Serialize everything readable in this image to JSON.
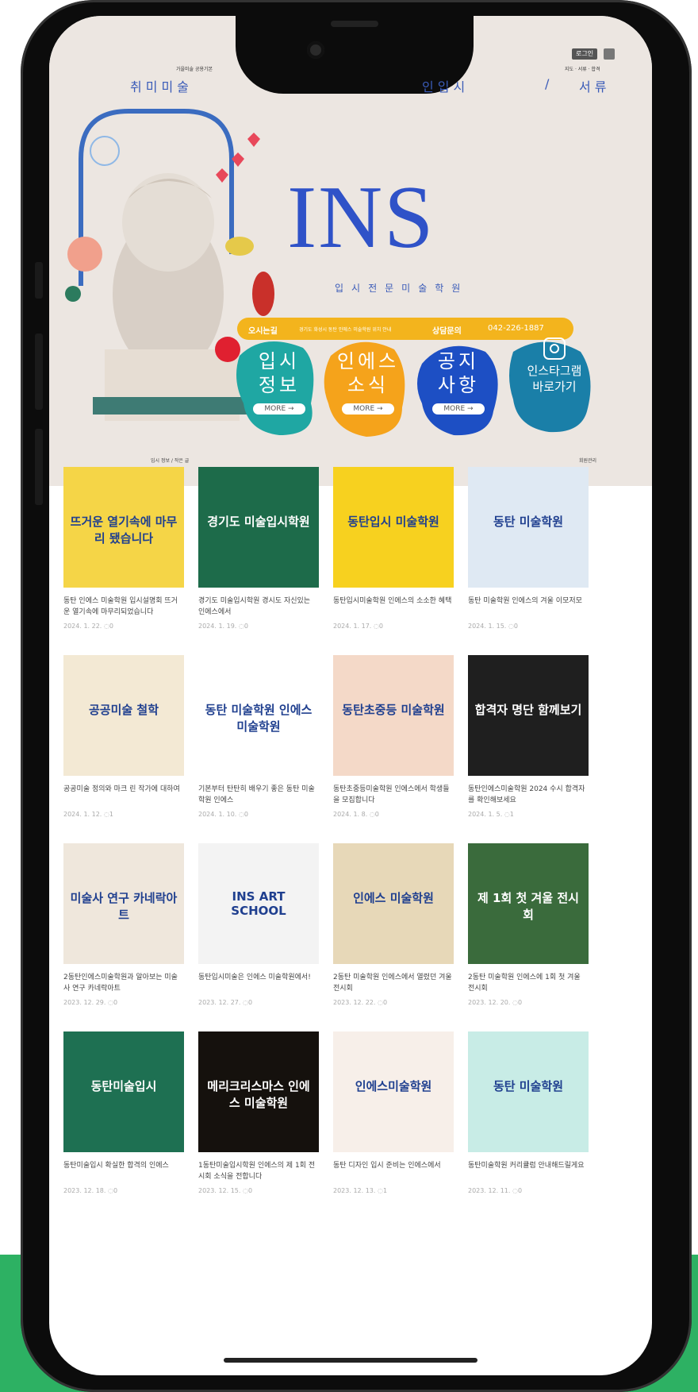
{
  "nav": {
    "left_small": "가을미술 공용기본",
    "left": "취미미술",
    "right": "인입시",
    "sep": "/",
    "right_small": "지도 · 서류 · 합격",
    "right2": "서류",
    "login": "로그인"
  },
  "hero": {
    "title": "INS",
    "subtitle": "입시전문미술학원",
    "info_directions_label": "오시는길",
    "info_directions_text": "경기도 화성시 동탄 인에스 미술학원 위치 안내",
    "info_phone_label": "상담문의",
    "info_phone": "042-226-1887",
    "buttons": [
      {
        "label": "입시\n정보",
        "more": "MORE →"
      },
      {
        "label": "인에스\n소식",
        "more": "MORE →"
      },
      {
        "label": "공지\n사항",
        "more": "MORE →"
      },
      {
        "label": "인스타그램\n바로가기",
        "more": ""
      }
    ],
    "footnote_left": "입시 정보 / 작은 글",
    "footnote_right": "회원관리"
  },
  "posts": [
    {
      "thumb": "뜨거운 열기속에 마무리 됐습니다",
      "caption": "동탄 인에스 미술학원 입시설명회 뜨거운 열기속에 마무리되었습니다",
      "date": "2024. 1. 22.",
      "comments": "0",
      "bg": "#f5d547"
    },
    {
      "thumb": "경기도 미술입시학원",
      "caption": "경기도 미술입시학원 경시도 자신있는 인에스에서",
      "date": "2024. 1. 19.",
      "comments": "0",
      "bg": "#1d6b4a"
    },
    {
      "thumb": "동탄입시 미술학원",
      "caption": "동탄입시미술학원 인에스의 소소한 혜택",
      "date": "2024. 1. 17.",
      "comments": "0",
      "bg": "#f7d11f"
    },
    {
      "thumb": "동탄 미술학원",
      "caption": "동탄 미술학원 인에스의 겨울 이모저모",
      "date": "2024. 1. 15.",
      "comments": "0",
      "bg": "#dfe9f3"
    },
    {
      "thumb": "공공미술 철학",
      "caption": "공공미술 정의와 마크 린 작가에 대하여",
      "date": "2024. 1. 12.",
      "comments": "1",
      "bg": "#f3e9d4"
    },
    {
      "thumb": "동탄 미술학원 인에스 미술학원",
      "caption": "기본부터 탄탄히 배우기 좋은 동탄 미술학원 인에스",
      "date": "2024. 1. 10.",
      "comments": "0",
      "bg": "#ffffff"
    },
    {
      "thumb": "동탄초중등 미술학원",
      "caption": "동탄초중등미술학원 인에스에서 학생들을 모집합니다",
      "date": "2024. 1. 8.",
      "comments": "0",
      "bg": "#f4d9c8"
    },
    {
      "thumb": "합격자 명단 함께보기",
      "caption": "동탄인에스미술학원 2024 수시 합격자를 확인해보세요",
      "date": "2024. 1. 5.",
      "comments": "1",
      "bg": "#1f1f1f"
    },
    {
      "thumb": "미술사 연구 카네락아트",
      "caption": "2동탄인에스미술학원과 알아보는 미술사 연구 카네락아트",
      "date": "2023. 12. 29.",
      "comments": "0",
      "bg": "#efe7dc"
    },
    {
      "thumb": "INS ART SCHOOL",
      "caption": "동탄입시미술은 인에스 미술학원에서!",
      "date": "2023. 12. 27.",
      "comments": "0",
      "bg": "#f3f3f3"
    },
    {
      "thumb": "인에스 미술학원",
      "caption": "2동탄 미술학원 인에스에서 열렸던 겨울전시회",
      "date": "2023. 12. 22.",
      "comments": "0",
      "bg": "#e7d8b8"
    },
    {
      "thumb": "제 1회 첫 겨울 전시회",
      "caption": "2동탄 미술학원 인에스에 1회 첫 겨울 전시회",
      "date": "2023. 12. 20.",
      "comments": "0",
      "bg": "#3a6b3c"
    },
    {
      "thumb": "동탄미술입시",
      "caption": "동탄미술입시 확실한 합격의 인에스",
      "date": "2023. 12. 18.",
      "comments": "0",
      "bg": "#1e7052"
    },
    {
      "thumb": "메리크리스마스 인에스 미술학원",
      "caption": "1동탄미술입시학원 인에스의 제 1회 전시회 소식을 전합니다",
      "date": "2023. 12. 15.",
      "comments": "0",
      "bg": "#15110d"
    },
    {
      "thumb": "인에스미술학원",
      "caption": "동탄 디자인 입시 준비는 인에스에서",
      "date": "2023. 12. 13.",
      "comments": "1",
      "bg": "#f7efe9"
    },
    {
      "thumb": "동탄 미술학원",
      "caption": "동탄미술학원 커리큘럼 안내해드릴게요",
      "date": "2023. 12. 11.",
      "comments": "0",
      "bg": "#c8ece6"
    }
  ],
  "colors": {
    "brand_blue": "#2f52c8",
    "accent_yellow": "#f3b41d",
    "teal": "#1fa7a3",
    "orange": "#f5a31b",
    "blue_blob": "#1d4fc4",
    "green_band": "#2db163"
  }
}
